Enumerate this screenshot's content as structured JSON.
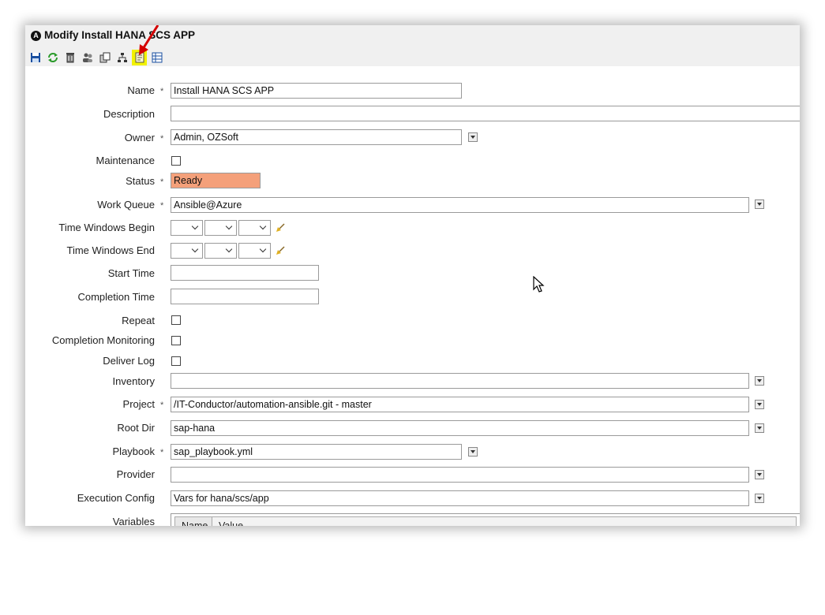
{
  "window": {
    "title": "Modify Install HANA SCS APP"
  },
  "toolbar": {
    "icons": [
      "save-icon",
      "refresh-icon",
      "delete-icon",
      "users-icon",
      "copy-icon",
      "hierarchy-icon",
      "edit-note-icon",
      "grid-icon"
    ],
    "highlight_color": "#f2f200"
  },
  "form": {
    "name": {
      "label": "Name",
      "value": "Install HANA SCS APP",
      "required": "*"
    },
    "description": {
      "label": "Description",
      "value": ""
    },
    "owner": {
      "label": "Owner",
      "value": "Admin, OZSoft",
      "required": "*"
    },
    "maintenance": {
      "label": "Maintenance"
    },
    "status": {
      "label": "Status",
      "value": "Ready",
      "required": "*",
      "color": "#f4a07a"
    },
    "work_queue": {
      "label": "Work Queue",
      "value": "Ansible@Azure",
      "required": "*"
    },
    "time_begin": {
      "label": "Time Windows Begin"
    },
    "time_end": {
      "label": "Time Windows End"
    },
    "start_time": {
      "label": "Start Time",
      "value": ""
    },
    "completion_time": {
      "label": "Completion Time",
      "value": ""
    },
    "repeat": {
      "label": "Repeat"
    },
    "completion_monitoring": {
      "label": "Completion Monitoring"
    },
    "deliver_log": {
      "label": "Deliver Log"
    },
    "inventory": {
      "label": "Inventory",
      "value": ""
    },
    "project": {
      "label": "Project",
      "value": "/IT-Conductor/automation-ansible.git - master",
      "required": "*"
    },
    "root_dir": {
      "label": "Root Dir",
      "value": "sap-hana"
    },
    "playbook": {
      "label": "Playbook",
      "value": "sap_playbook.yml",
      "required": "*"
    },
    "provider": {
      "label": "Provider",
      "value": ""
    },
    "execution_config": {
      "label": "Execution Config",
      "value": "Vars for hana/scs/app"
    },
    "variables": {
      "label": "Variables",
      "col_name": "Name",
      "col_value": "Value"
    }
  }
}
